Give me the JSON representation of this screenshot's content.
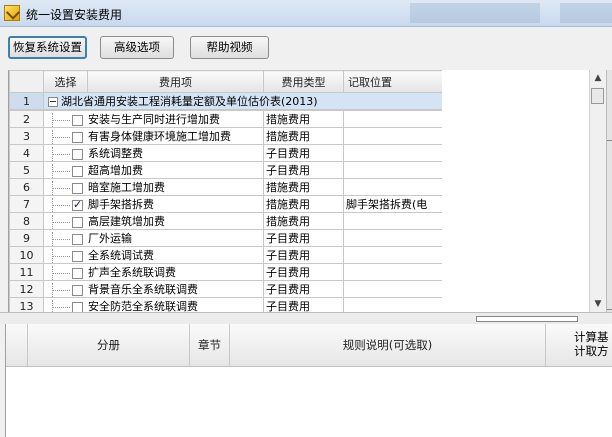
{
  "window": {
    "title": "统一设置安装费用"
  },
  "toolbar": {
    "restore_label": "恢复系统设置",
    "advanced_label": "高级选项",
    "help_label": "帮助视频"
  },
  "grid": {
    "headers": {
      "select": "选择",
      "item": "费用项",
      "type": "费用类型",
      "position": "记取位置"
    },
    "group": {
      "num": "1",
      "label": "湖北省通用安装工程消耗量定额及单位估价表(2013)"
    },
    "rows": [
      {
        "num": "2",
        "label": "安装与生产同时进行增加费",
        "type": "措施费用",
        "position": ""
      },
      {
        "num": "3",
        "label": "有害身体健康环境施工增加费",
        "type": "措施费用",
        "position": ""
      },
      {
        "num": "4",
        "label": "系统调整费",
        "type": "子目费用",
        "position": ""
      },
      {
        "num": "5",
        "label": "超高增加费",
        "type": "子目费用",
        "position": ""
      },
      {
        "num": "6",
        "label": "暗室施工增加费",
        "type": "措施费用",
        "position": ""
      },
      {
        "num": "7",
        "label": "脚手架搭拆费",
        "type": "措施费用",
        "position": "脚手架搭拆费(电"
      },
      {
        "num": "8",
        "label": "高层建筑增加费",
        "type": "措施费用",
        "position": ""
      },
      {
        "num": "9",
        "label": "厂外运输",
        "type": "子目费用",
        "position": ""
      },
      {
        "num": "10",
        "label": "全系统调试费",
        "type": "子目费用",
        "position": ""
      },
      {
        "num": "11",
        "label": "扩声全系统联调费",
        "type": "子目费用",
        "position": ""
      },
      {
        "num": "12",
        "label": "背景音乐全系统联调费",
        "type": "子目费用",
        "position": ""
      },
      {
        "num": "13",
        "label": "安全防范全系统联调费",
        "type": "子目费用",
        "position": ""
      }
    ],
    "checked_rows": [
      "7"
    ]
  },
  "lower_grid": {
    "headers": {
      "volume": "分册",
      "chapter": "章节",
      "rule": "规则说明(可选取)",
      "calc_line1": "计算基",
      "calc_line2": "计取方"
    }
  }
}
